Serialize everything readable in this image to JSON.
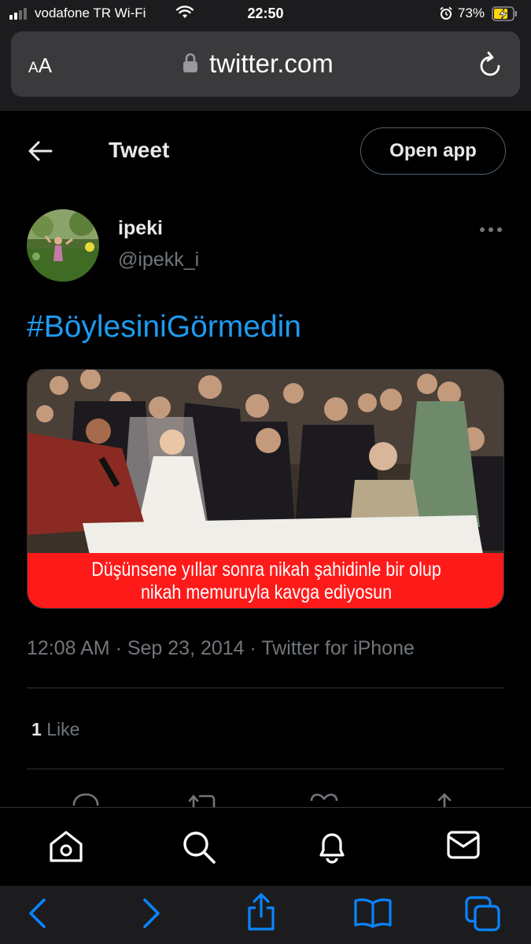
{
  "status_bar": {
    "carrier": "vodafone TR Wi-Fi",
    "time": "22:50",
    "battery_percent": "73%",
    "signal_bars_filled": 2,
    "signal_bars_total": 4,
    "icons": [
      "signal-icon",
      "wifi-icon",
      "alarm-icon",
      "battery-charging-icon"
    ]
  },
  "safari": {
    "text_size_button": "AA",
    "url": "twitter.com",
    "icons": [
      "lock-icon",
      "reload-icon"
    ],
    "toolbar": [
      "back-icon",
      "forward-icon",
      "share-icon",
      "bookmarks-icon",
      "tabs-icon"
    ]
  },
  "header": {
    "title": "Tweet",
    "open_app_label": "Open app",
    "back_icon": "arrow-left-icon"
  },
  "tweet": {
    "display_name": "ipeki",
    "handle": "@ipekk_i",
    "text": "#BöylesiniGörmedin",
    "media": {
      "caption_line_1": "Düşünsene yıllar sonra nikah şahidinle bir olup",
      "caption_line_2": "nikah memuruyla kavga ediyosun"
    },
    "timestamp_line": "12:08 AM · Sep 23, 2014 · Twitter for iPhone",
    "like_count": "1",
    "like_label": "Like",
    "actions": [
      "reply-icon",
      "retweet-icon",
      "like-icon",
      "share-icon"
    ]
  },
  "bottom_nav": {
    "items": [
      "home-icon",
      "search-icon",
      "notifications-icon",
      "messages-icon"
    ]
  },
  "colors": {
    "background": "#000000",
    "link_blue": "#1d9bf0",
    "secondary_text": "#71767b",
    "caption_red": "#ff1a1a",
    "safari_chrome": "#1c1c1e"
  }
}
